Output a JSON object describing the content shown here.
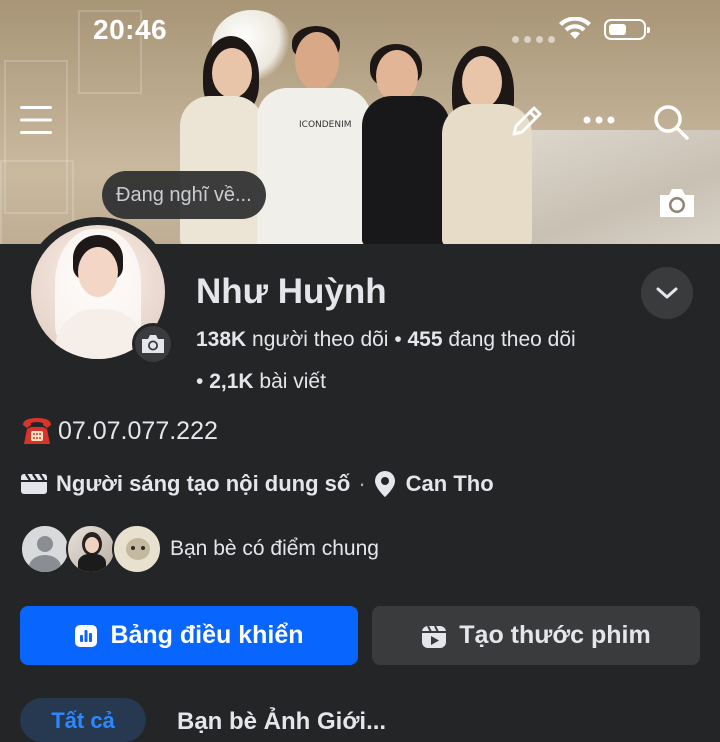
{
  "status_bar": {
    "time": "20:46"
  },
  "header": {
    "thought_placeholder": "Đang nghĩ về..."
  },
  "profile": {
    "name": "Như Huỳnh",
    "followers_count": "138K",
    "followers_label": "người theo dõi",
    "following_count": "455",
    "following_label": "đang theo dõi",
    "posts_count": "2,1K",
    "posts_label": "bài viết",
    "phone": "07.07.077.222",
    "category": "Người sáng tạo nội dung số",
    "separator": "·",
    "location": "Can Tho",
    "mutual_friends_label": "Bạn bè có điểm chung"
  },
  "actions": {
    "dashboard_label": "Bảng điều khiển",
    "create_reel_label": "Tạo thước phim"
  },
  "tabs": {
    "first_tab": "Tất cả",
    "next_text": "Bạn bè   Ảnh   Giới..."
  },
  "colors": {
    "background": "#242526",
    "primary_button": "#0866ff",
    "secondary_button": "#3a3b3c",
    "text": "#e4e6eb"
  },
  "icons": {
    "menu": "hamburger-menu-icon",
    "edit": "pencil-icon",
    "more": "more-dots-icon",
    "search": "search-icon",
    "camera": "camera-icon",
    "expand": "chevron-down-icon",
    "phone": "telephone-emoji-icon",
    "category": "clapper-icon",
    "location": "location-pin-icon",
    "dashboard": "bar-chart-icon",
    "reel": "reel-icon"
  }
}
